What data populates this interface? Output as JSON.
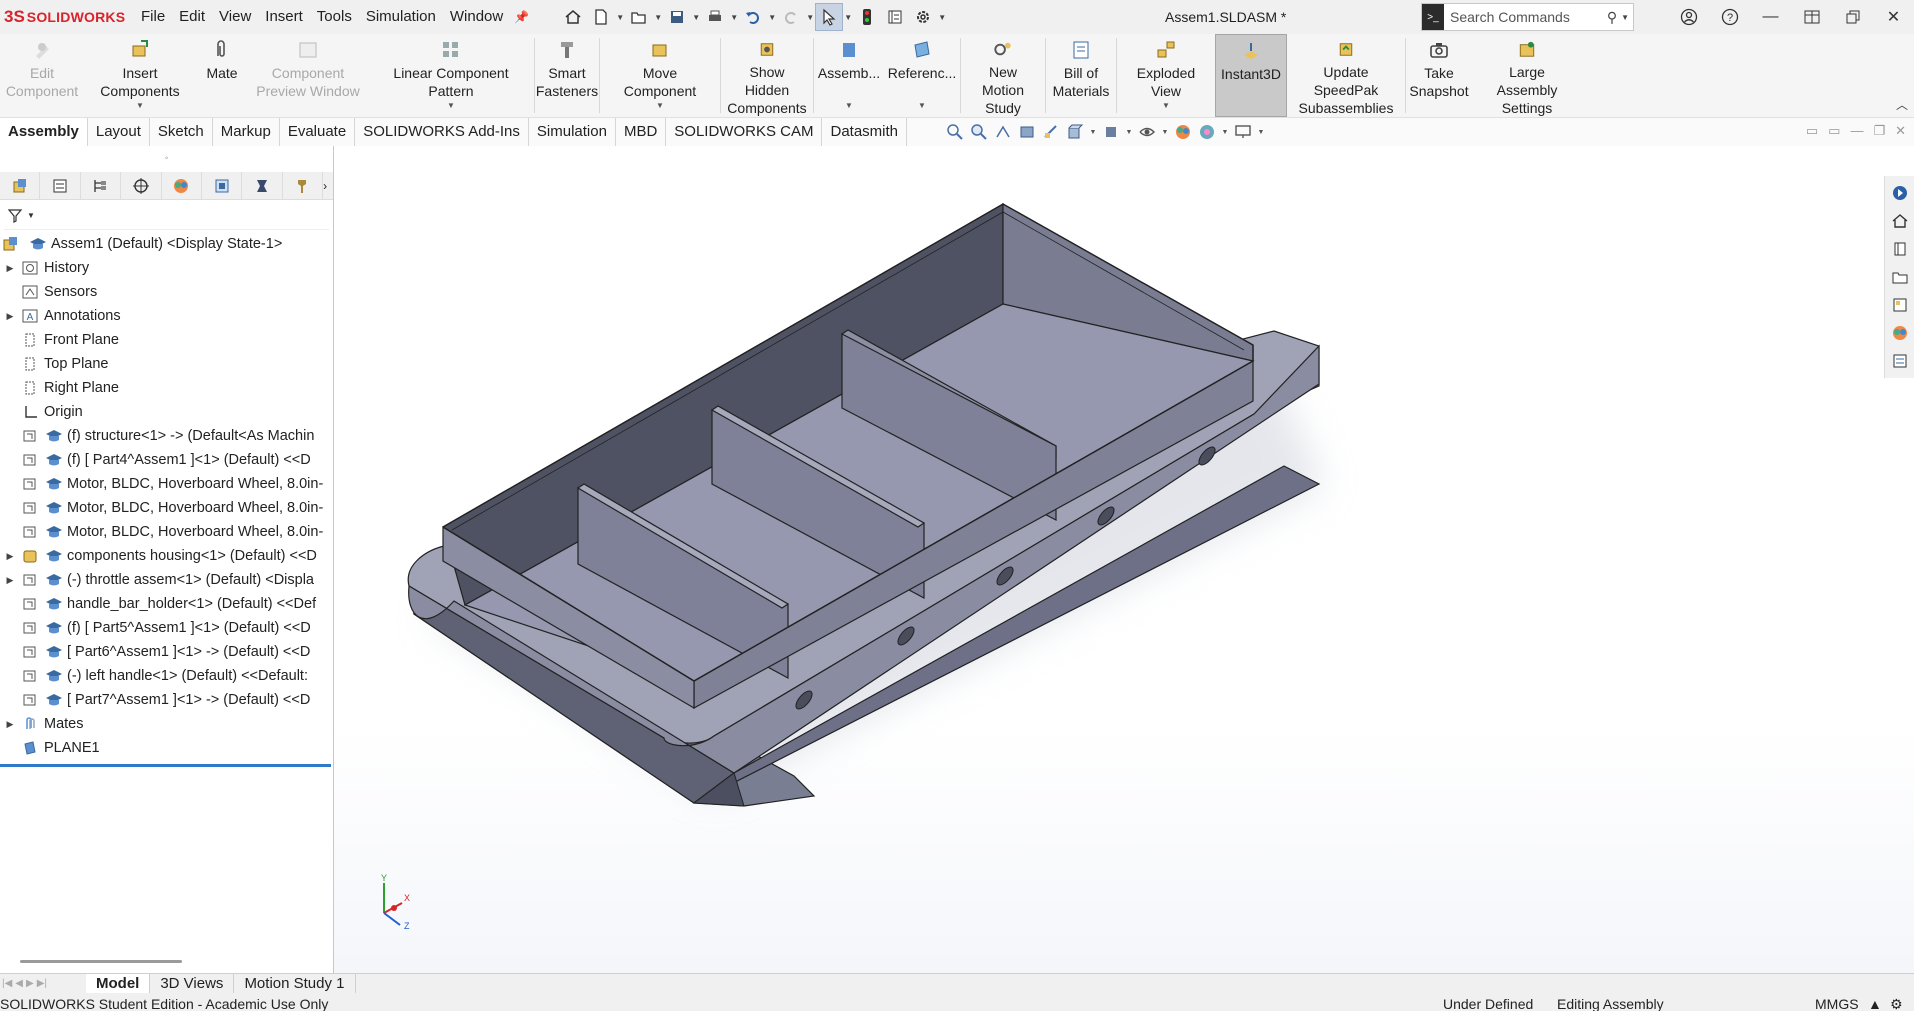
{
  "app": {
    "logo_mark": "3S",
    "logo_text": "SOLIDWORKS",
    "document_title": "Assem1.SLDASM *"
  },
  "menu": [
    "File",
    "Edit",
    "View",
    "Insert",
    "Tools",
    "Simulation",
    "Window"
  ],
  "search": {
    "placeholder": "Search Commands"
  },
  "ribbon": {
    "edit_component": [
      "Edit",
      "Component"
    ],
    "insert_components": "Insert Components",
    "mate": "Mate",
    "component_preview": [
      "Component",
      "Preview Window"
    ],
    "linear_pattern": "Linear Component Pattern",
    "smart_fasteners": [
      "Smart",
      "Fasteners"
    ],
    "move_component": "Move Component",
    "show_hidden": [
      "Show Hidden",
      "Components"
    ],
    "assembly": "Assemb...",
    "reference": "Referenc...",
    "new_motion": [
      "New Motion",
      "Study"
    ],
    "bom": [
      "Bill of",
      "Materials"
    ],
    "exploded": "Exploded View",
    "instant3d": "Instant3D",
    "speedpak": [
      "Update SpeedPak",
      "Subassemblies"
    ],
    "snapshot": [
      "Take",
      "Snapshot"
    ],
    "large_assembly": [
      "Large Assembly",
      "Settings"
    ]
  },
  "tabs": [
    "Assembly",
    "Layout",
    "Sketch",
    "Markup",
    "Evaluate",
    "SOLIDWORKS Add-Ins",
    "Simulation",
    "MBD",
    "SOLIDWORKS CAM",
    "Datasmith"
  ],
  "tree": [
    {
      "label": "Assem1 (Default) <Display State-1>"
    },
    {
      "label": "History"
    },
    {
      "label": "Sensors"
    },
    {
      "label": "Annotations"
    },
    {
      "label": "Front Plane"
    },
    {
      "label": "Top Plane"
    },
    {
      "label": "Right Plane"
    },
    {
      "label": "Origin"
    },
    {
      "label": "(f) structure<1> -> (Default<As Machin"
    },
    {
      "label": "(f) [ Part4^Assem1 ]<1> (Default) <<D"
    },
    {
      "label": "Motor, BLDC, Hoverboard Wheel, 8.0in-"
    },
    {
      "label": "Motor, BLDC, Hoverboard Wheel, 8.0in-"
    },
    {
      "label": "Motor, BLDC, Hoverboard Wheel, 8.0in-"
    },
    {
      "label": "components housing<1> (Default) <<D"
    },
    {
      "label": "(-) throttle assem<1> (Default) <Displa"
    },
    {
      "label": "handle_bar_holder<1> (Default) <<Def"
    },
    {
      "label": "(f) [ Part5^Assem1 ]<1> (Default) <<D"
    },
    {
      "label": "[ Part6^Assem1 ]<1> -> (Default) <<D"
    },
    {
      "label": "(-) left handle<1> (Default) <<Default:"
    },
    {
      "label": "[ Part7^Assem1 ]<1> -> (Default) <<D"
    },
    {
      "label": "Mates"
    },
    {
      "label": "PLANE1"
    }
  ],
  "bottom_tabs": [
    "Model",
    "3D Views",
    "Motion Study 1"
  ],
  "status": {
    "edition": "SOLIDWORKS Student Edition - Academic Use Only",
    "defined": "Under Defined",
    "mode": "Editing Assembly",
    "units": "MMGS"
  },
  "triad": {
    "x": "X",
    "y": "Y",
    "z": "Z"
  },
  "colors": {
    "brand": "#d8232a",
    "model_light": "#9a9db0",
    "model_dark": "#5a5d6e",
    "selection_line": "#2f79c9"
  }
}
